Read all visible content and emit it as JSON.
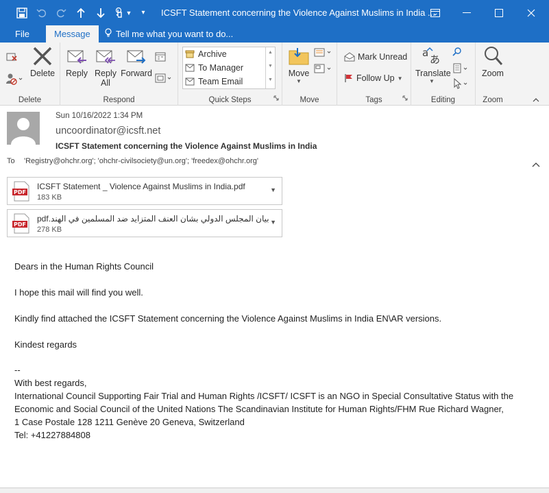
{
  "window": {
    "title": "ICSFT Statement concerning the Violence Against Muslims in India ..."
  },
  "tabs": {
    "file": "File",
    "message": "Message",
    "tell_me": "Tell me what you want to do..."
  },
  "ribbon": {
    "delete_group": {
      "label": "Delete",
      "delete": "Delete"
    },
    "respond_group": {
      "label": "Respond",
      "reply": "Reply",
      "reply_all_1": "Reply",
      "reply_all_2": "All",
      "forward": "Forward"
    },
    "quick_steps": {
      "label": "Quick Steps",
      "items": [
        "Archive",
        "To Manager",
        "Team Email"
      ]
    },
    "move_group": {
      "label": "Move",
      "move": "Move"
    },
    "tags_group": {
      "label": "Tags",
      "mark_unread": "Mark Unread",
      "follow_up": "Follow Up"
    },
    "editing_group": {
      "label": "Editing",
      "translate": "Translate"
    },
    "zoom_group": {
      "label": "Zoom",
      "zoom": "Zoom"
    }
  },
  "header": {
    "date": "Sun 10/16/2022 1:34 PM",
    "from": "uncoordinator@icsft.net",
    "subject": "ICSFT Statement concerning the Violence Against Muslims in India",
    "to_label": "To",
    "to": "'Registry@ohchr.org'; 'ohchr-civilsociety@un.org'; 'freedex@ohchr.org'"
  },
  "attachments": [
    {
      "name": "ICSFT Statement _ Violence Against Muslims in India.pdf",
      "size": "183 KB",
      "badge": "PDF"
    },
    {
      "name": "بيان المجلس الدولي بشان العنف المتزايد ضد المسلمين في الهند.pdf",
      "size": "278 KB",
      "badge": "PDF"
    }
  ],
  "body": {
    "greeting": "Dears in the Human Rights Council",
    "line1": "I hope this mail will find you well.",
    "line2": "Kindly find attached the ICSFT Statement concerning the Violence Against Muslims in India EN\\AR versions.",
    "closing": "Kindest regards",
    "sig_sep": "--",
    "sig1": "With best regards,",
    "sig2": "International Council Supporting Fair Trial and Human Rights /ICSFT/ ICSFT is an NGO in Special Consultative Status with the",
    "sig3": "Economic and Social Council of the United Nations The Scandinavian Institute for Human Rights/FHM Rue Richard Wagner,",
    "sig4": "1 Case Postale 128 1211 Genève 20 Geneva, Switzerland",
    "sig5": "Tel: +41227884808"
  },
  "colors": {
    "accent": "#1e6fc6",
    "ribbon_bg": "#f3f3f3",
    "pdf_red": "#c7252b"
  }
}
